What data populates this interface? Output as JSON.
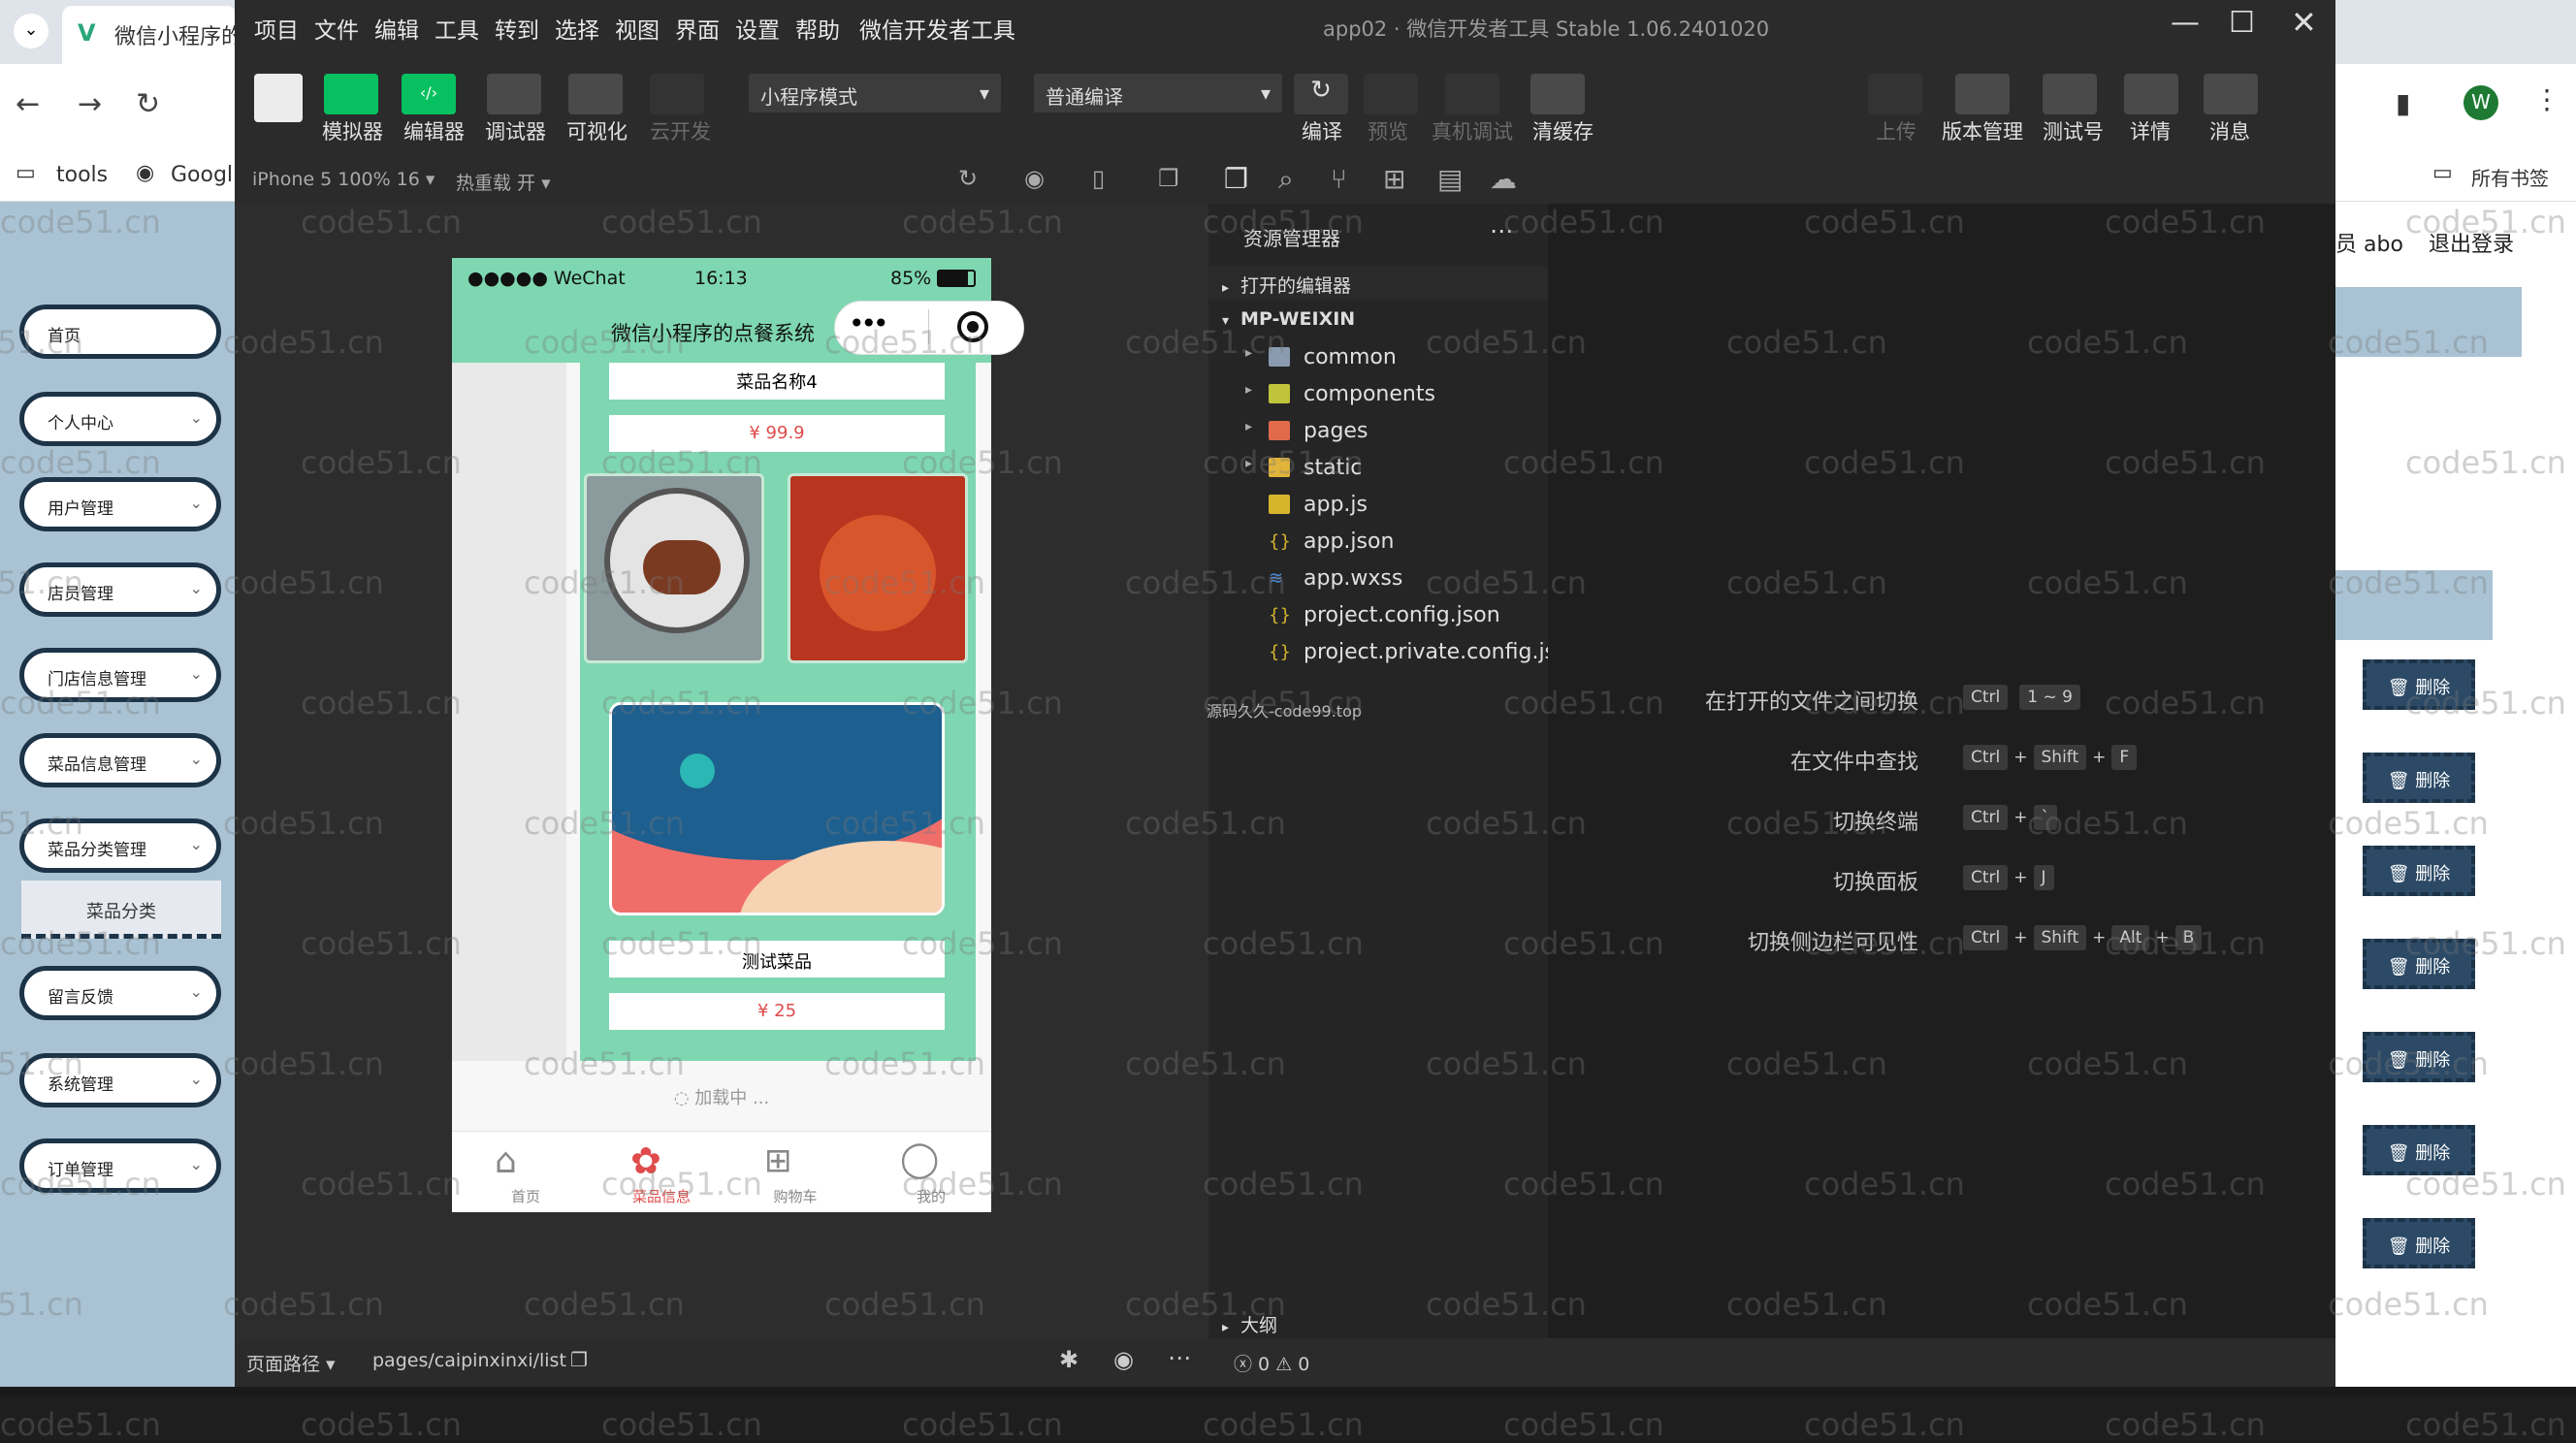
{
  "browser": {
    "tab_title": "微信小程序的",
    "bookmarks": [
      "tools",
      "Googl"
    ],
    "all_bookmarks": "所有书签",
    "header_user": "员 abo",
    "logout": "退出登录",
    "avatar_letter": "W",
    "sidebar": [
      {
        "label": "首页"
      },
      {
        "label": "个人中心"
      },
      {
        "label": "用户管理"
      },
      {
        "label": "店员管理"
      },
      {
        "label": "门店信息管理"
      },
      {
        "label": "菜品信息管理"
      },
      {
        "label": "菜品分类管理"
      },
      {
        "label": "留言反馈"
      },
      {
        "label": "系统管理"
      },
      {
        "label": "订单管理"
      }
    ],
    "sidebar_sub": "菜品分类",
    "delete_label": "删除"
  },
  "devtools": {
    "menu": [
      "项目",
      "文件",
      "编辑",
      "工具",
      "转到",
      "选择",
      "视图",
      "界面",
      "设置",
      "帮助",
      "微信开发者工具"
    ],
    "window_title": "app02 · 微信开发者工具 Stable 1.06.2401020",
    "toolbar_left": [
      "模拟器",
      "编辑器",
      "调试器",
      "可视化",
      "云开发"
    ],
    "mode_select": "小程序模式",
    "compile_select": "普通编译",
    "toolbar_mid": [
      "编译",
      "预览",
      "真机调试",
      "清缓存"
    ],
    "toolbar_right": [
      "上传",
      "版本管理",
      "测试号",
      "详情",
      "消息"
    ],
    "device": "iPhone 5 100% 16 ▾",
    "hotreload": "热重载 开 ▾",
    "explorer_title": "资源管理器",
    "open_editors": "打开的编辑器",
    "project_root": "MP-WEIXIN",
    "files": [
      {
        "name": "common",
        "type": "folder"
      },
      {
        "name": "components",
        "type": "folder-green"
      },
      {
        "name": "pages",
        "type": "folder-red"
      },
      {
        "name": "static",
        "type": "folder"
      },
      {
        "name": "app.js",
        "type": "js"
      },
      {
        "name": "app.json",
        "type": "json"
      },
      {
        "name": "app.wxss",
        "type": "wxss"
      },
      {
        "name": "project.config.json",
        "type": "json"
      },
      {
        "name": "project.private.config.js...",
        "type": "json"
      }
    ],
    "outline": "大纲",
    "watermark_text": "源码久久-code99.top",
    "shortcuts": [
      {
        "label": "在打开的文件之间切换",
        "keys": [
          "Ctrl",
          "1 ~ 9"
        ]
      },
      {
        "label": "在文件中查找",
        "keys": [
          "Ctrl",
          "+",
          "Shift",
          "+",
          "F"
        ]
      },
      {
        "label": "切换终端",
        "keys": [
          "Ctrl",
          "+",
          "`"
        ]
      },
      {
        "label": "切换面板",
        "keys": [
          "Ctrl",
          "+",
          "J"
        ]
      },
      {
        "label": "切换侧边栏可见性",
        "keys": [
          "Ctrl",
          "+",
          "Shift",
          "+",
          "Alt",
          "+",
          "B"
        ]
      }
    ],
    "page_path_label": "页面路径 ▾",
    "page_path": "pages/caipinxinxi/list",
    "errors": "ⓧ 0 ⚠ 0"
  },
  "phone": {
    "carrier": "●●●●● WeChat",
    "time": "16:13",
    "battery": "85%",
    "title": "微信小程序的点餐系统",
    "item1_name": "菜品名称4",
    "item1_price": "¥ 99.9",
    "item2_name": "测试菜品",
    "item2_price": "¥ 25",
    "loading": "加载中 ...",
    "tabs": [
      "首页",
      "菜品信息",
      "购物车",
      "我的"
    ]
  },
  "watermark": "code51.cn",
  "colors": {
    "accent_green": "#07c160",
    "phone_theme": "#7ed7b1",
    "admin_navy": "#1c3348"
  }
}
